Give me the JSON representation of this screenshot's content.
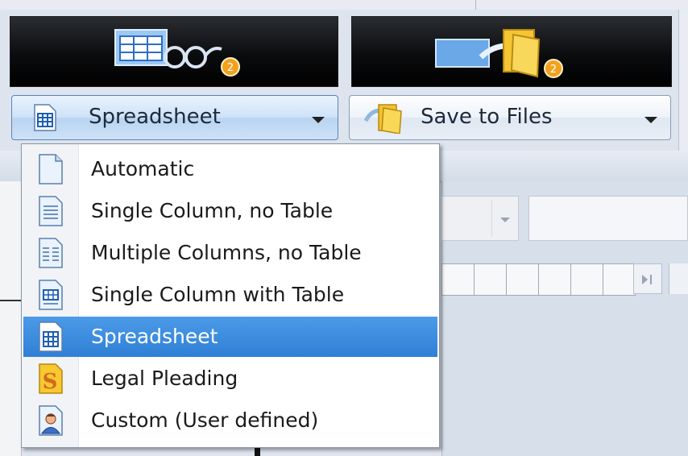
{
  "toolbar": {
    "workflow_step_1": {
      "icon": "spreadsheet-glasses-icon",
      "badge": "2"
    },
    "workflow_step_2": {
      "icon": "save-to-folder-icon",
      "badge": "2"
    },
    "layout_dropdown": {
      "label": "Spreadsheet",
      "icon": "spreadsheet-icon"
    },
    "save_dropdown": {
      "label": "Save to Files",
      "icon": "folder-icon"
    }
  },
  "layout_menu": {
    "selected_index": 4,
    "items": [
      {
        "label": "Automatic",
        "icon": "blank-document-icon"
      },
      {
        "label": "Single Column, no Table",
        "icon": "single-column-document-icon"
      },
      {
        "label": "Multiple Columns, no Table",
        "icon": "multi-column-document-icon"
      },
      {
        "label": "Single Column with Table",
        "icon": "table-document-icon"
      },
      {
        "label": "Spreadsheet",
        "icon": "spreadsheet-icon"
      },
      {
        "label": "Legal Pleading",
        "icon": "legal-pleading-icon"
      },
      {
        "label": "Custom (User defined)",
        "icon": "custom-user-icon"
      }
    ]
  },
  "colors": {
    "selection": "#3a8be0",
    "button_dark": "#0b0c0e",
    "badge": "#f2a21f"
  }
}
